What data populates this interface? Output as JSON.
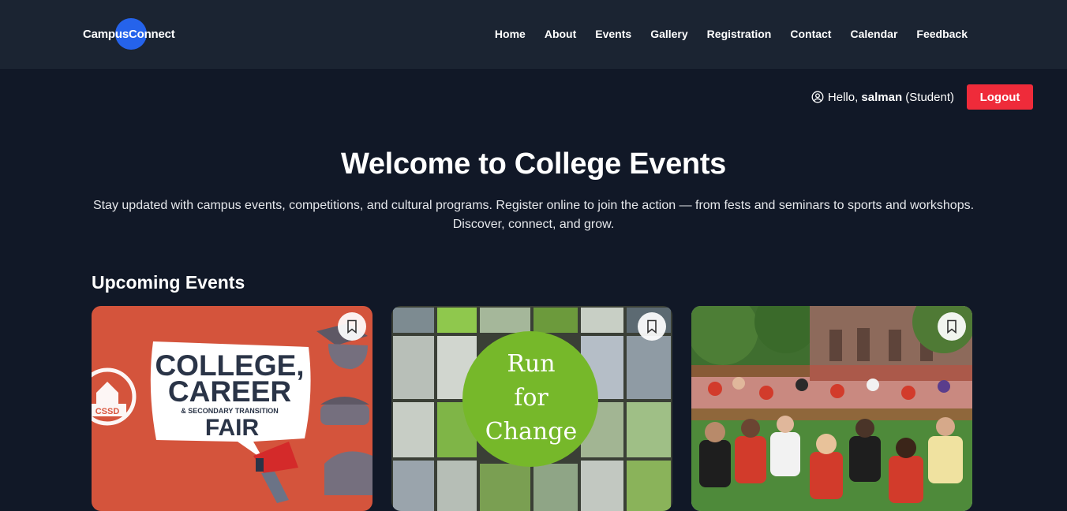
{
  "brand": {
    "name": "CampusConnect"
  },
  "nav": {
    "links": [
      "Home",
      "About",
      "Events",
      "Gallery",
      "Registration",
      "Contact",
      "Calendar",
      "Feedback"
    ]
  },
  "user": {
    "hello": "Hello, ",
    "name": "salman",
    "role": " (Student)",
    "logout_label": "Logout",
    "icon": "user-circle-icon"
  },
  "hero": {
    "title": "Welcome to College Events",
    "description": "Stay updated with campus events, competitions, and cultural programs. Register online to join the action — from fests and seminars to sports and workshops. Discover, connect, and grow."
  },
  "upcoming": {
    "title": "Upcoming Events",
    "cards": [
      {
        "logo_text": "CSSD",
        "poster_line1": "COLLEGE,",
        "poster_line2": "CAREER",
        "poster_line3": "& SECONDARY TRANSITION",
        "poster_line4": "FAIR",
        "bookmark_icon": "bookmark-icon"
      },
      {
        "poster_line1": "Run",
        "poster_line2": "for",
        "poster_line3": "Change",
        "bookmark_icon": "bookmark-icon"
      },
      {
        "bookmark_icon": "bookmark-icon"
      }
    ]
  },
  "colors": {
    "page_bg": "#111827",
    "navbar_bg": "#1b2432",
    "brand_accent": "#2563eb",
    "logout": "#ef2b3a",
    "card1_bg": "#d9573f",
    "card2_circle": "#76b82a"
  }
}
